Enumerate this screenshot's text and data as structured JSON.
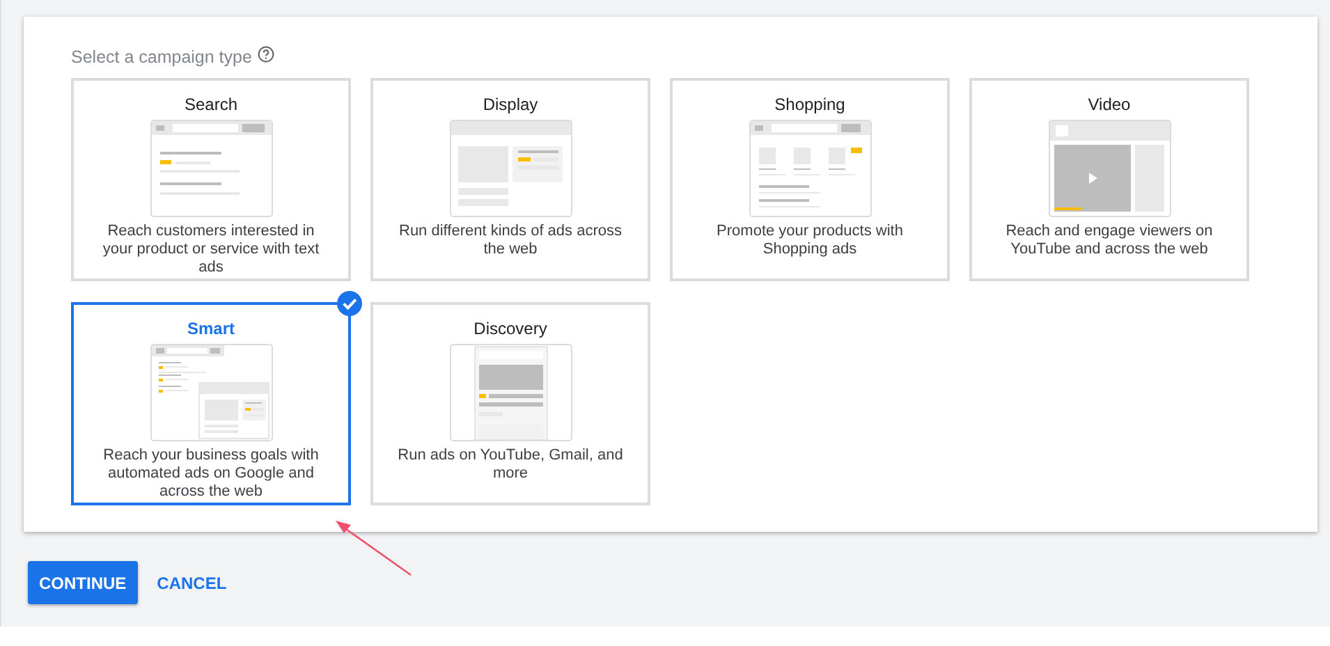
{
  "prompt": {
    "label": "Select a campaign type",
    "help_icon": true
  },
  "campaign_types": [
    {
      "kind": "search",
      "title": "Search",
      "description": "Reach customers interested in your product or service with text ads",
      "selected": false
    },
    {
      "kind": "display",
      "title": "Display",
      "description": "Run different kinds of ads across the web",
      "selected": false
    },
    {
      "kind": "shopping",
      "title": "Shopping",
      "description": "Promote your products with Shopping ads",
      "selected": false
    },
    {
      "kind": "video",
      "title": "Video",
      "description": "Reach and engage viewers on YouTube and across the web",
      "selected": false
    },
    {
      "kind": "smart",
      "title": "Smart",
      "description": "Reach your business goals with automated ads on Google and across the web",
      "selected": true
    },
    {
      "kind": "discovery",
      "title": "Discovery",
      "description": "Run ads on YouTube, Gmail, and more",
      "selected": false
    }
  ],
  "buttons": [
    {
      "kind": "primary",
      "label": "CONTINUE"
    },
    {
      "kind": "text",
      "label": "CANCEL"
    }
  ],
  "annotation_arrow": true
}
